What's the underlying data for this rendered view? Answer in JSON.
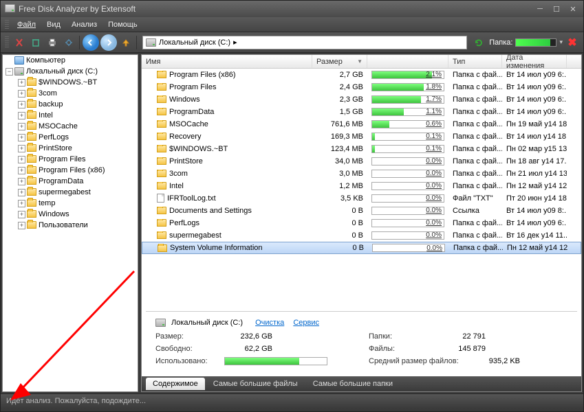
{
  "title": "Free Disk Analyzer by Extensoft",
  "menu": {
    "file": "Файл",
    "view": "Вид",
    "analysis": "Анализ",
    "help": "Помощь"
  },
  "toolbar": {
    "folder_label": "Папка:",
    "progress_pct": 85
  },
  "breadcrumb": {
    "text": "Локальный диск (C:)",
    "arrow": "▸"
  },
  "tree": {
    "root": "Компьютер",
    "drive": "Локальный диск (C:)",
    "items": [
      "$WINDOWS.~BT",
      "3com",
      "backup",
      "Intel",
      "MSOCache",
      "PerfLogs",
      "PrintStore",
      "Program Files",
      "Program Files (x86)",
      "ProgramData",
      "supermegabest",
      "temp",
      "Windows",
      "Пользователи"
    ]
  },
  "columns": {
    "name": "Имя",
    "size": "Размер",
    "type": "Тип",
    "date": "Дата изменения"
  },
  "rows": [
    {
      "name": "Program Files (x86)",
      "size": "2,7 GB",
      "pct": "2.1%",
      "pctv": 2.1,
      "type": "Папка с фай...",
      "date": "Вт 14 июл у09 6:...",
      "icon": "folder"
    },
    {
      "name": "Program Files",
      "size": "2,4 GB",
      "pct": "1.8%",
      "pctv": 1.8,
      "type": "Папка с фай...",
      "date": "Вт 14 июл у09 6:...",
      "icon": "folder"
    },
    {
      "name": "Windows",
      "size": "2,3 GB",
      "pct": "1.7%",
      "pctv": 1.7,
      "type": "Папка с фай...",
      "date": "Вт 14 июл у09 6:...",
      "icon": "folder"
    },
    {
      "name": "ProgramData",
      "size": "1,5 GB",
      "pct": "1.1%",
      "pctv": 1.1,
      "type": "Папка с фай...",
      "date": "Вт 14 июл у09 6:...",
      "icon": "folder"
    },
    {
      "name": "MSOCache",
      "size": "761,6 MB",
      "pct": "0.6%",
      "pctv": 0.6,
      "type": "Папка с фай...",
      "date": "Пн 19 май у14 18...",
      "icon": "folder"
    },
    {
      "name": "Recovery",
      "size": "169,3 MB",
      "pct": "0.1%",
      "pctv": 0.1,
      "type": "Папка с фай...",
      "date": "Вт 14 июл у14 18...",
      "icon": "folder"
    },
    {
      "name": "$WINDOWS.~BT",
      "size": "123,4 MB",
      "pct": "0.1%",
      "pctv": 0.1,
      "type": "Папка с фай...",
      "date": "Пн 02 мар у15 13...",
      "icon": "folder"
    },
    {
      "name": "PrintStore",
      "size": "34,0 MB",
      "pct": "0.0%",
      "pctv": 0,
      "type": "Папка с фай...",
      "date": "Пн 18 авг у14 17...",
      "icon": "folder"
    },
    {
      "name": "3com",
      "size": "3,0 MB",
      "pct": "0.0%",
      "pctv": 0,
      "type": "Папка с фай...",
      "date": "Пн 21 июл у14 13...",
      "icon": "folder"
    },
    {
      "name": "Intel",
      "size": "1,2 MB",
      "pct": "0.0%",
      "pctv": 0,
      "type": "Папка с фай...",
      "date": "Пн 12 май у14 12...",
      "icon": "folder"
    },
    {
      "name": "IFRToolLog.txt",
      "size": "3,5 KB",
      "pct": "0.0%",
      "pctv": 0,
      "type": "Файл \"TXT\"",
      "date": "Пт 20 июн у14 18...",
      "icon": "file"
    },
    {
      "name": "Documents and Settings",
      "size": "0 B",
      "pct": "0.0%",
      "pctv": 0,
      "type": "Ссылка",
      "date": "Вт 14 июл у09 8:...",
      "icon": "folder"
    },
    {
      "name": "PerfLogs",
      "size": "0 B",
      "pct": "0.0%",
      "pctv": 0,
      "type": "Папка с фай...",
      "date": "Вт 14 июл у09 6:...",
      "icon": "folder"
    },
    {
      "name": "supermegabest",
      "size": "0 B",
      "pct": "0.0%",
      "pctv": 0,
      "type": "Папка с фай...",
      "date": "Вт 16 дек у14 11...",
      "icon": "folder"
    },
    {
      "name": "System Volume Information",
      "size": "0 B",
      "pct": "0.0%",
      "pctv": 0,
      "type": "Папка с фай...",
      "date": "Пн 12 май у14 12...",
      "icon": "folder",
      "selected": true
    }
  ],
  "summary": {
    "drive": "Локальный диск (C:)",
    "links": {
      "clean": "Очистка",
      "service": "Сервис"
    },
    "left": {
      "size_label": "Размер:",
      "size_val": "232,6 GB",
      "free_label": "Свободно:",
      "free_val": "62,2 GB",
      "used_label": "Использовано:",
      "used_pct": 73
    },
    "right": {
      "folders_label": "Папки:",
      "folders_val": "22 791",
      "files_label": "Файлы:",
      "files_val": "145 879",
      "avg_label": "Средний размер файлов:",
      "avg_val": "935,2  KB"
    }
  },
  "tabs": {
    "content": "Содержимое",
    "big_files": "Самые большие файлы",
    "big_folders": "Самые большие папки"
  },
  "status": "Идёт анализ. Пожалуйста, подождите..."
}
